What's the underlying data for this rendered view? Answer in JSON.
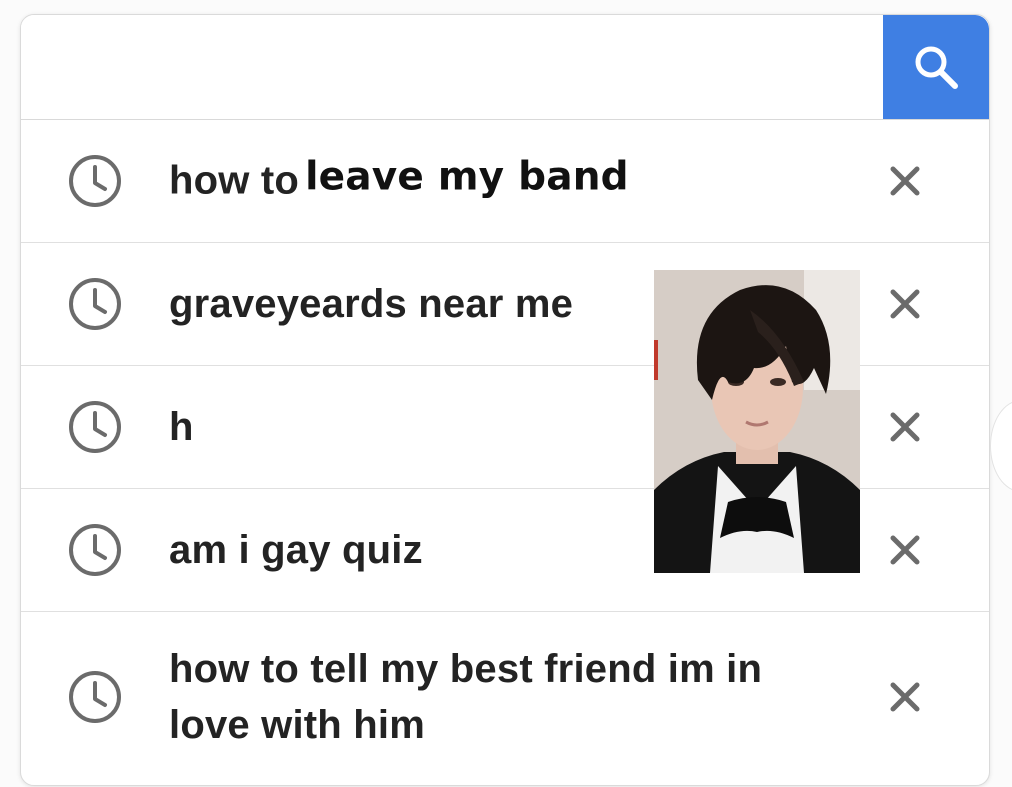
{
  "search": {
    "value": "",
    "placeholder": "",
    "button_icon": "search-icon",
    "accent_color": "#3f7fe3"
  },
  "suggestions": [
    {
      "icon": "clock-icon",
      "prefix": "how to",
      "overlay": "leave my band",
      "remove_icon": "close-icon"
    },
    {
      "icon": "clock-icon",
      "text": "graveyeards near me",
      "remove_icon": "close-icon"
    },
    {
      "icon": "clock-icon",
      "text": "h",
      "remove_icon": "close-icon"
    },
    {
      "icon": "clock-icon",
      "text": "am i gay quiz",
      "remove_icon": "close-icon"
    },
    {
      "icon": "clock-icon",
      "text": "how to tell my best friend im in love with him",
      "remove_icon": "close-icon"
    }
  ]
}
